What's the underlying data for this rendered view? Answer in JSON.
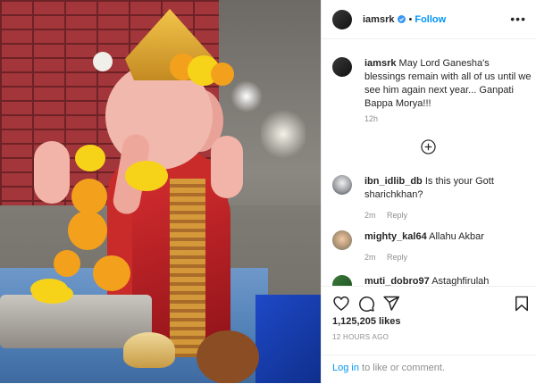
{
  "post": {
    "username": "iamsrk",
    "follow_label": "Follow",
    "separator": "•",
    "more_label": "•••"
  },
  "caption": {
    "username": "iamsrk",
    "text": "May Lord Ganesha's blessings remain with all of us until we see him again next year... Ganpati Bappa Morya!!!",
    "time": "12h"
  },
  "comments": [
    {
      "username": "ibn_idlib_db",
      "text": "Is this your Gott sharichkhan?",
      "time": "2m",
      "reply_label": "Reply"
    },
    {
      "username": "mighty_kal64",
      "text": "Allahu Akbar",
      "time": "2m",
      "reply_label": "Reply"
    },
    {
      "username": "muti_dobro97",
      "text": "Astaghfirulah",
      "time": "",
      "reply_label": ""
    }
  ],
  "actions": {
    "likes": "1,125,205 likes",
    "timestamp": "12 HOURS AGO",
    "login_link": "Log in",
    "login_rest": " to like or comment."
  },
  "colors": {
    "accent": "#0095f6",
    "muted": "#8e8e8e",
    "text": "#262626"
  },
  "icons": [
    "verified-icon",
    "more-icon",
    "add-comment-icon",
    "heart-icon",
    "comment-icon",
    "share-icon",
    "bookmark-icon"
  ]
}
